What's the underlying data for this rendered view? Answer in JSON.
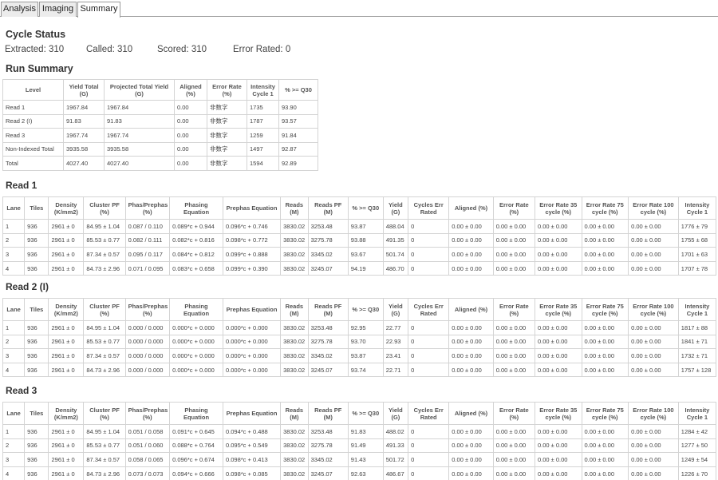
{
  "tabs": [
    {
      "label": "Analysis",
      "active": false
    },
    {
      "label": "Imaging",
      "active": false
    },
    {
      "label": "Summary",
      "active": true
    }
  ],
  "cycle_status": {
    "title": "Cycle Status",
    "extracted": "Extracted: 310",
    "called": "Called: 310",
    "scored": "Scored: 310",
    "error_rated": "Error Rated: 0"
  },
  "run_summary": {
    "title": "Run Summary",
    "headers": [
      "Level",
      "Yield Total (G)",
      "Projected Total Yield (G)",
      "Aligned (%)",
      "Error Rate (%)",
      "Intensity Cycle 1",
      "% >= Q30"
    ],
    "rows": [
      [
        "Read 1",
        "1967.84",
        "1967.84",
        "0.00",
        "非数字",
        "1735",
        "93.90"
      ],
      [
        "Read 2 (I)",
        "91.83",
        "91.83",
        "0.00",
        "非数字",
        "1787",
        "93.57"
      ],
      [
        "Read 3",
        "1967.74",
        "1967.74",
        "0.00",
        "非数字",
        "1259",
        "91.84"
      ],
      [
        "Non-Indexed Total",
        "3935.58",
        "3935.58",
        "0.00",
        "非数字",
        "1497",
        "92.87"
      ],
      [
        "Total",
        "4027.40",
        "4027.40",
        "0.00",
        "非数字",
        "1594",
        "92.89"
      ]
    ]
  },
  "reads": [
    {
      "title": "Read 1",
      "headers": [
        "Lane",
        "Tiles",
        "Density (K/mm2)",
        "Cluster PF (%)",
        "Phas/Prephas (%)",
        "Phasing Equation",
        "Prephas Equation",
        "Reads (M)",
        "Reads PF (M)",
        "% >= Q30",
        "Yield (G)",
        "Cycles Err Rated",
        "Aligned (%)",
        "Error Rate (%)",
        "Error Rate 35 cycle (%)",
        "Error Rate 75 cycle (%)",
        "Error Rate 100 cycle (%)",
        "Intensity Cycle 1"
      ],
      "rows": [
        [
          "1",
          "936",
          "2961 ± 0",
          "84.95 ± 1.04",
          "0.087 / 0.110",
          "0.089*c + 0.944",
          "0.096*c + 0.746",
          "3830.02",
          "3253.48",
          "93.87",
          "488.04",
          "0",
          "0.00 ± 0.00",
          "0.00 ± 0.00",
          "0.00 ± 0.00",
          "0.00 ± 0.00",
          "0.00 ± 0.00",
          "1776 ± 79"
        ],
        [
          "2",
          "936",
          "2961 ± 0",
          "85.53 ± 0.77",
          "0.082 / 0.111",
          "0.082*c + 0.816",
          "0.098*c + 0.772",
          "3830.02",
          "3275.78",
          "93.88",
          "491.35",
          "0",
          "0.00 ± 0.00",
          "0.00 ± 0.00",
          "0.00 ± 0.00",
          "0.00 ± 0.00",
          "0.00 ± 0.00",
          "1755 ± 68"
        ],
        [
          "3",
          "936",
          "2961 ± 0",
          "87.34 ± 0.57",
          "0.095 / 0.117",
          "0.084*c + 0.812",
          "0.099*c + 0.888",
          "3830.02",
          "3345.02",
          "93.67",
          "501.74",
          "0",
          "0.00 ± 0.00",
          "0.00 ± 0.00",
          "0.00 ± 0.00",
          "0.00 ± 0.00",
          "0.00 ± 0.00",
          "1701 ± 63"
        ],
        [
          "4",
          "936",
          "2961 ± 0",
          "84.73 ± 2.96",
          "0.071 / 0.095",
          "0.083*c + 0.658",
          "0.099*c + 0.390",
          "3830.02",
          "3245.07",
          "94.19",
          "486.70",
          "0",
          "0.00 ± 0.00",
          "0.00 ± 0.00",
          "0.00 ± 0.00",
          "0.00 ± 0.00",
          "0.00 ± 0.00",
          "1707 ± 78"
        ]
      ]
    },
    {
      "title": "Read 2 (I)",
      "headers": [
        "Lane",
        "Tiles",
        "Density (K/mm2)",
        "Cluster PF (%)",
        "Phas/Prephas (%)",
        "Phasing Equation",
        "Prephas Equation",
        "Reads (M)",
        "Reads PF (M)",
        "% >= Q30",
        "Yield (G)",
        "Cycles Err Rated",
        "Aligned (%)",
        "Error Rate (%)",
        "Error Rate 35 cycle (%)",
        "Error Rate 75 cycle (%)",
        "Error Rate 100 cycle (%)",
        "Intensity Cycle 1"
      ],
      "rows": [
        [
          "1",
          "936",
          "2961 ± 0",
          "84.95 ± 1.04",
          "0.000 / 0.000",
          "0.000*c + 0.000",
          "0.000*c + 0.000",
          "3830.02",
          "3253.48",
          "92.95",
          "22.77",
          "0",
          "0.00 ± 0.00",
          "0.00 ± 0.00",
          "0.00 ± 0.00",
          "0.00 ± 0.00",
          "0.00 ± 0.00",
          "1817 ± 88"
        ],
        [
          "2",
          "936",
          "2961 ± 0",
          "85.53 ± 0.77",
          "0.000 / 0.000",
          "0.000*c + 0.000",
          "0.000*c + 0.000",
          "3830.02",
          "3275.78",
          "93.70",
          "22.93",
          "0",
          "0.00 ± 0.00",
          "0.00 ± 0.00",
          "0.00 ± 0.00",
          "0.00 ± 0.00",
          "0.00 ± 0.00",
          "1841 ± 71"
        ],
        [
          "3",
          "936",
          "2961 ± 0",
          "87.34 ± 0.57",
          "0.000 / 0.000",
          "0.000*c + 0.000",
          "0.000*c + 0.000",
          "3830.02",
          "3345.02",
          "93.87",
          "23.41",
          "0",
          "0.00 ± 0.00",
          "0.00 ± 0.00",
          "0.00 ± 0.00",
          "0.00 ± 0.00",
          "0.00 ± 0.00",
          "1732 ± 71"
        ],
        [
          "4",
          "936",
          "2961 ± 0",
          "84.73 ± 2.96",
          "0.000 / 0.000",
          "0.000*c + 0.000",
          "0.000*c + 0.000",
          "3830.02",
          "3245.07",
          "93.74",
          "22.71",
          "0",
          "0.00 ± 0.00",
          "0.00 ± 0.00",
          "0.00 ± 0.00",
          "0.00 ± 0.00",
          "0.00 ± 0.00",
          "1757 ± 128"
        ]
      ]
    },
    {
      "title": "Read 3",
      "headers": [
        "Lane",
        "Tiles",
        "Density (K/mm2)",
        "Cluster PF (%)",
        "Phas/Prephas (%)",
        "Phasing Equation",
        "Prephas Equation",
        "Reads (M)",
        "Reads PF (M)",
        "% >= Q30",
        "Yield (G)",
        "Cycles Err Rated",
        "Aligned (%)",
        "Error Rate (%)",
        "Error Rate 35 cycle (%)",
        "Error Rate 75 cycle (%)",
        "Error Rate 100 cycle (%)",
        "Intensity Cycle 1"
      ],
      "rows": [
        [
          "1",
          "936",
          "2961 ± 0",
          "84.95 ± 1.04",
          "0.051 / 0.058",
          "0.091*c + 0.645",
          "0.094*c + 0.488",
          "3830.02",
          "3253.48",
          "91.83",
          "488.02",
          "0",
          "0.00 ± 0.00",
          "0.00 ± 0.00",
          "0.00 ± 0.00",
          "0.00 ± 0.00",
          "0.00 ± 0.00",
          "1284 ± 42"
        ],
        [
          "2",
          "936",
          "2961 ± 0",
          "85.53 ± 0.77",
          "0.051 / 0.060",
          "0.088*c + 0.764",
          "0.095*c + 0.549",
          "3830.02",
          "3275.78",
          "91.49",
          "491.33",
          "0",
          "0.00 ± 0.00",
          "0.00 ± 0.00",
          "0.00 ± 0.00",
          "0.00 ± 0.00",
          "0.00 ± 0.00",
          "1277 ± 50"
        ],
        [
          "3",
          "936",
          "2961 ± 0",
          "87.34 ± 0.57",
          "0.058 / 0.065",
          "0.096*c + 0.674",
          "0.098*c + 0.413",
          "3830.02",
          "3345.02",
          "91.43",
          "501.72",
          "0",
          "0.00 ± 0.00",
          "0.00 ± 0.00",
          "0.00 ± 0.00",
          "0.00 ± 0.00",
          "0.00 ± 0.00",
          "1249 ± 54"
        ],
        [
          "4",
          "936",
          "2961 ± 0",
          "84.73 ± 2.96",
          "0.073 / 0.073",
          "0.094*c + 0.666",
          "0.098*c + 0.085",
          "3830.02",
          "3245.07",
          "92.63",
          "486.67",
          "0",
          "0.00 ± 0.00",
          "0.00 ± 0.00",
          "0.00 ± 0.00",
          "0.00 ± 0.00",
          "0.00 ± 0.00",
          "1226 ± 70"
        ]
      ]
    }
  ]
}
